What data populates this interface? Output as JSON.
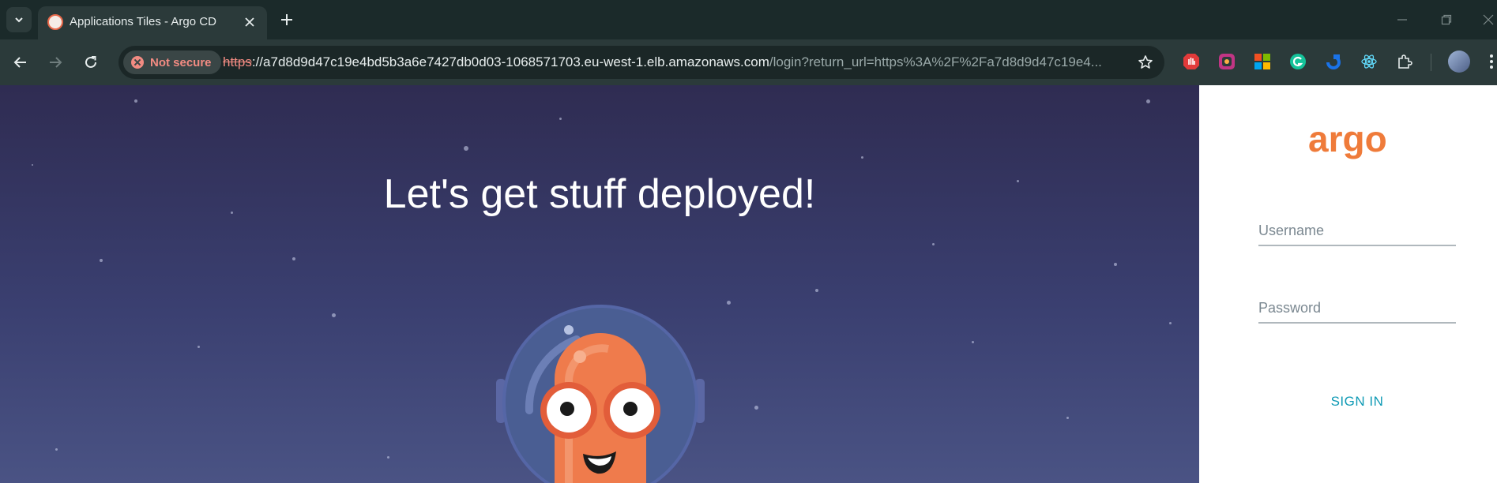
{
  "browser": {
    "tab_title": "Applications Tiles - Argo CD",
    "security_label": "Not secure",
    "url_scheme": "https",
    "url_host": "://a7d8d9d47c19e4bd5b3a6e7427db0d03-1068571703.eu-west-1.elb.amazonaws.com",
    "url_path": "/login?return_url=https%3A%2F%2Fa7d8d9d47c19e4..."
  },
  "hero": {
    "title": "Let's get stuff deployed!"
  },
  "login": {
    "logo_text": "argo",
    "username_placeholder": "Username",
    "password_placeholder": "Password",
    "signin_label": "SIGN IN"
  },
  "colors": {
    "accent": "#ef7b3a",
    "link": "#0f9ab5",
    "hero_bg": "#3a3f70"
  },
  "icons": [
    "tab-search-icon",
    "argo-favicon-icon",
    "close-icon",
    "plus-icon",
    "back-arrow-icon",
    "forward-arrow-icon",
    "reload-icon",
    "not-secure-icon",
    "star-icon",
    "extension-icons",
    "profile-avatar",
    "more-menu-icon"
  ]
}
